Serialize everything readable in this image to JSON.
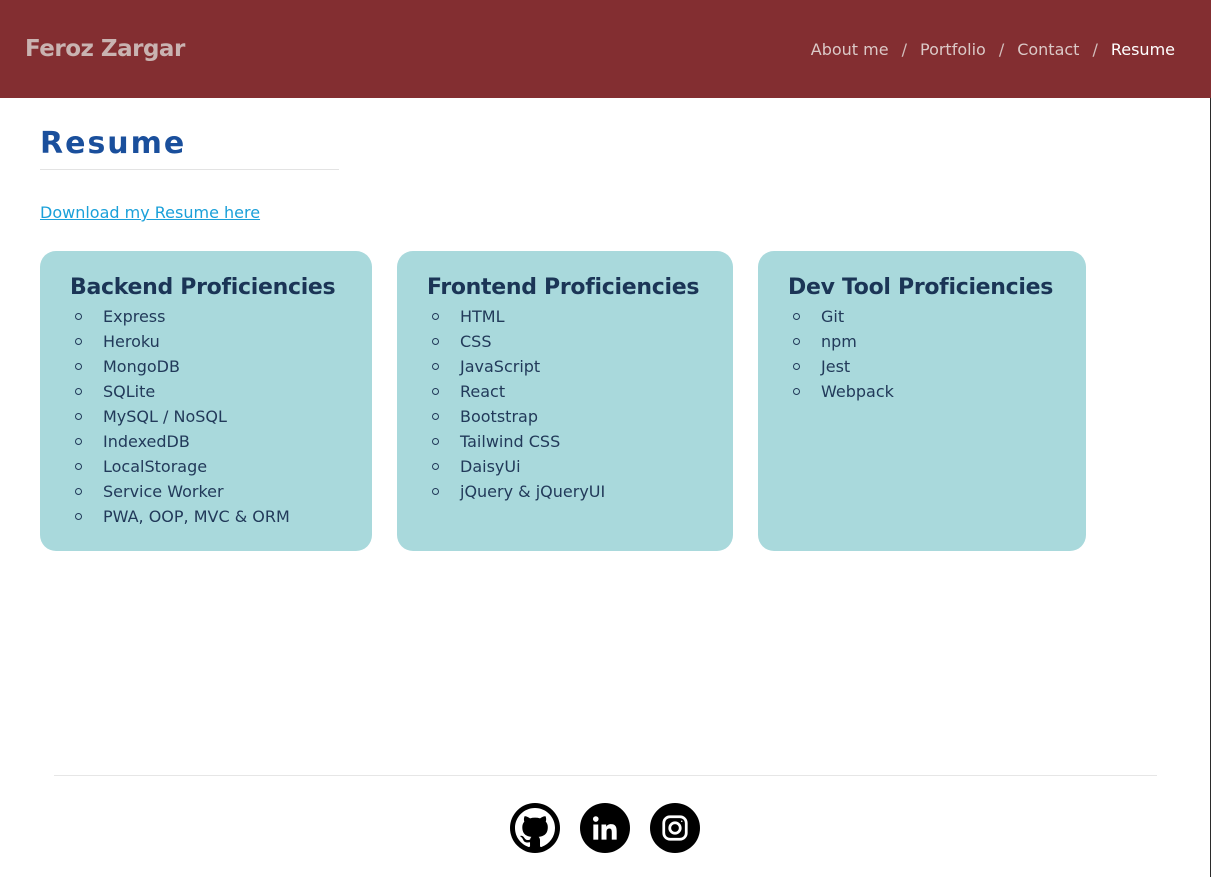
{
  "header": {
    "brand": "Feroz Zargar",
    "nav": [
      "About me",
      "Portfolio",
      "Contact",
      "Resume"
    ],
    "separator": "/",
    "active": "Resume"
  },
  "page": {
    "title": "Resume",
    "download_link": "Download my Resume here"
  },
  "cards": {
    "backend": {
      "title": "Backend Proficiencies",
      "items": [
        "Express",
        "Heroku",
        "MongoDB",
        "SQLite",
        "MySQL / NoSQL",
        "IndexedDB",
        "LocalStorage",
        "Service Worker",
        "PWA, OOP, MVC & ORM"
      ]
    },
    "frontend": {
      "title": "Frontend Proficiencies",
      "items": [
        "HTML",
        "CSS",
        "JavaScript",
        "React",
        "Bootstrap",
        "Tailwind CSS",
        "DaisyUi",
        "jQuery & jQueryUI"
      ]
    },
    "devtool": {
      "title": "Dev Tool Proficiencies",
      "items": [
        "Git",
        "npm",
        "Jest",
        "Webpack"
      ]
    }
  },
  "footer": {
    "social_icons": [
      "github-icon",
      "linkedin-icon",
      "instagram-icon"
    ]
  },
  "colors": {
    "header_bg": "#832e31",
    "title": "#1a4f9c",
    "card_bg": "#a9d9dc",
    "link": "#1aa0d9"
  }
}
